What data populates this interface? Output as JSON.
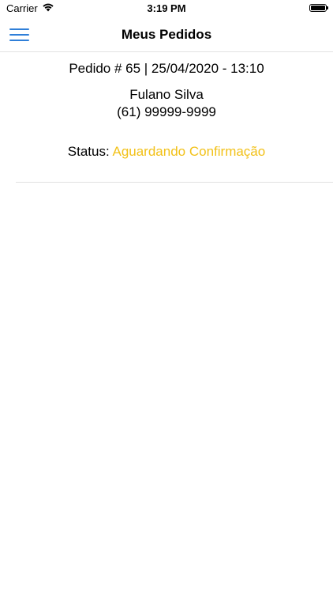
{
  "status_bar": {
    "carrier": "Carrier",
    "time": "3:19 PM",
    "icons": [
      "wifi-icon",
      "battery-icon"
    ]
  },
  "nav": {
    "title": "Meus Pedidos",
    "menu_icon": "hamburger-menu-icon"
  },
  "order": {
    "header": "Pedido # 65 | 25/04/2020 - 13:10",
    "customer_name": "Fulano Silva",
    "customer_phone": "(61) 99999-9999",
    "status_label": "Status: ",
    "status_value": "Aguardando Confirmação"
  },
  "colors": {
    "accent": "#2f7fd8",
    "status_pending": "#f2c118",
    "separator": "#e2e2e2"
  }
}
